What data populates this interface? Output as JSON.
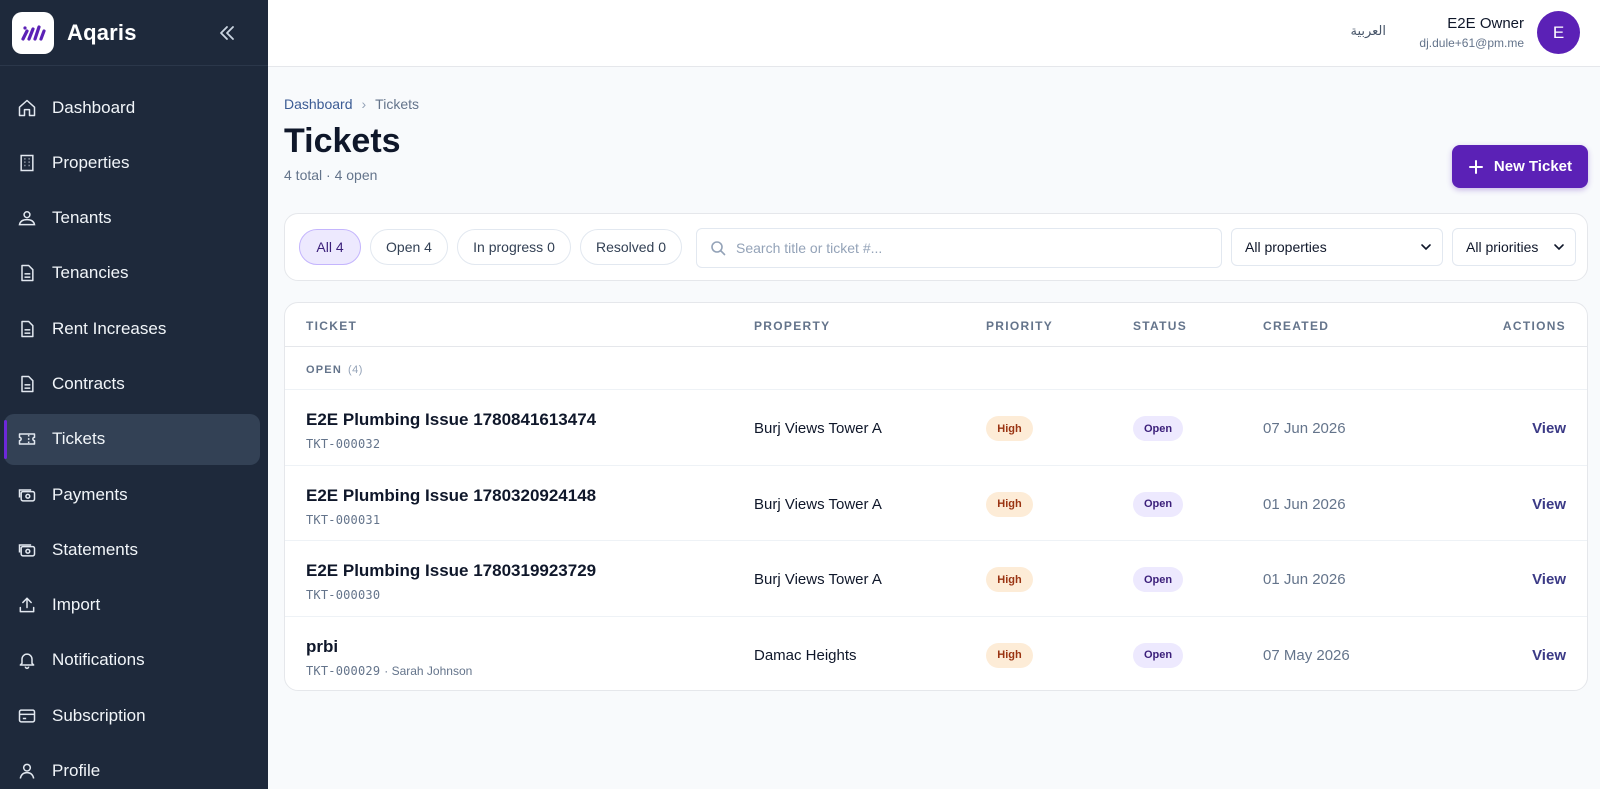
{
  "app": {
    "name": "Aqaris"
  },
  "colors": {
    "sidebar_bg": "#1e293b",
    "accent": "#5b21b6",
    "high_badge": "#fdecd7",
    "open_badge": "#ede9fe"
  },
  "sidebar": {
    "items": [
      {
        "label": "Dashboard",
        "icon": "home-icon"
      },
      {
        "label": "Properties",
        "icon": "building-icon"
      },
      {
        "label": "Tenants",
        "icon": "users-icon"
      },
      {
        "label": "Tenancies",
        "icon": "document-icon"
      },
      {
        "label": "Rent Increases",
        "icon": "document-icon"
      },
      {
        "label": "Contracts",
        "icon": "document-icon"
      },
      {
        "label": "Tickets",
        "icon": "ticket-icon",
        "active": true
      },
      {
        "label": "Payments",
        "icon": "banknote-icon"
      },
      {
        "label": "Statements",
        "icon": "banknote-icon"
      },
      {
        "label": "Import",
        "icon": "upload-icon"
      },
      {
        "label": "Notifications",
        "icon": "bell-icon"
      },
      {
        "label": "Subscription",
        "icon": "credit-card-icon"
      },
      {
        "label": "Profile",
        "icon": "user-icon"
      }
    ]
  },
  "topbar": {
    "language": "العربية",
    "user_name": "E2E Owner",
    "user_email": "dj.dule+61@pm.me",
    "avatar_initial": "E"
  },
  "breadcrumb": {
    "parent": "Dashboard",
    "separator": "›",
    "current": "Tickets"
  },
  "page": {
    "title": "Tickets",
    "summary": "4 total · 4 open",
    "new_button": "New Ticket"
  },
  "filters": {
    "chips": [
      "All 4",
      "Open 4",
      "In progress 0",
      "Resolved 0"
    ],
    "active_chip": "All 4",
    "search_placeholder": "Search title or ticket #...",
    "property_select": "All properties",
    "priority_select": "All priorities"
  },
  "table": {
    "headers": {
      "ticket": "TICKET",
      "property": "PROPERTY",
      "priority": "PRIORITY",
      "status": "STATUS",
      "created": "CREATED",
      "actions": "ACTIONS"
    },
    "group": {
      "label": "OPEN",
      "count": "(4)"
    },
    "rows": [
      {
        "title": "E2E Plumbing Issue 1780841613474",
        "number": "TKT-000032",
        "assignee": "",
        "property": "Burj Views Tower A",
        "priority": "High",
        "status": "Open",
        "created": "07 Jun 2026",
        "action": "View"
      },
      {
        "title": "E2E Plumbing Issue 1780320924148",
        "number": "TKT-000031",
        "assignee": "",
        "property": "Burj Views Tower A",
        "priority": "High",
        "status": "Open",
        "created": "01 Jun 2026",
        "action": "View"
      },
      {
        "title": "E2E Plumbing Issue 1780319923729",
        "number": "TKT-000030",
        "assignee": "",
        "property": "Burj Views Tower A",
        "priority": "High",
        "status": "Open",
        "created": "01 Jun 2026",
        "action": "View"
      },
      {
        "title": "prbi",
        "number": "TKT-000029",
        "assignee": "· Sarah Johnson",
        "property": "Damac Heights",
        "priority": "High",
        "status": "Open",
        "created": "07 May 2026",
        "action": "View"
      }
    ]
  }
}
